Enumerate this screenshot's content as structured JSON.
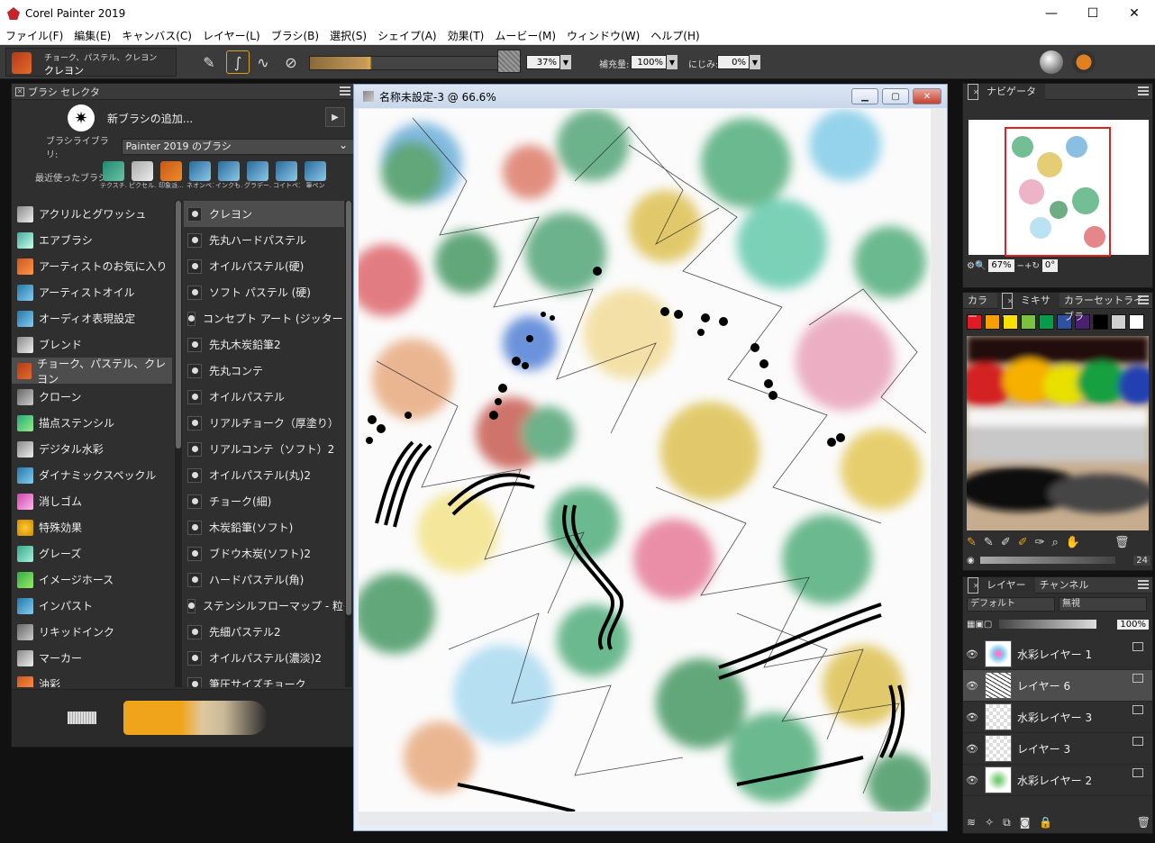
{
  "app": {
    "title": "Corel Painter 2019"
  },
  "window_controls": {
    "minimize": "—",
    "maximize": "☐",
    "close": "✕"
  },
  "menu": [
    "ファイル(F)",
    "編集(E)",
    "キャンバス(C)",
    "レイヤー(L)",
    "ブラシ(B)",
    "選択(S)",
    "シェイプ(A)",
    "効果(T)",
    "ムービー(M)",
    "ウィンドウ(W)",
    "ヘルプ(H)"
  ],
  "propbar": {
    "brush_category": "チョーク、パステル、クレヨン",
    "brush_variant": "クレヨン",
    "opacity": "37%",
    "resaturation_label": "補充量:",
    "resaturation": "100%",
    "bleed_label": "にじみ:",
    "bleed": "0%"
  },
  "brush_selector": {
    "title": "ブラシ セレクタ",
    "new_brush": "新ブラシの追加...",
    "library_label": "ブラシライブラリ:",
    "library": "Painter 2019 のブラシ",
    "recent_label": "最近使ったブラシ:",
    "recent": [
      "テクスチ...",
      "ピクセル...",
      "印象派...",
      "ネオンペン",
      "インクも...",
      "グラデー...",
      "コイトペン",
      "筆ペン"
    ],
    "categories": [
      "アクリルとグワッシュ",
      "エアブラシ",
      "アーティストのお気に入り",
      "アーティストオイル",
      "オーディオ表現設定",
      "ブレンド",
      "チョーク、パステル、クレヨン",
      "クローン",
      "描点ステンシル",
      "デジタル水彩",
      "ダイナミックスペックル",
      "消しゴム",
      "特殊効果",
      "グレーズ",
      "イメージホース",
      "インパスト",
      "リキッドインク",
      "マーカー",
      "油彩"
    ],
    "selected_category": 6,
    "variants": [
      "クレヨン",
      "先丸ハードパステル",
      "オイルパステル(硬)",
      "ソフト パステル (硬)",
      "コンセプト アート (ジッター スムーズ)",
      "先丸木炭鉛筆2",
      "先丸コンテ",
      "オイルパステル",
      "リアルチョーク（厚塗り）",
      "リアルコンテ（ソフト）2",
      "オイルパステル(丸)2",
      "チョーク(細)",
      "木炭鉛筆(ソフト)",
      "ブドウ木炭(ソフト)2",
      "ハードパステル(角)",
      "ステンシルフローマップ - 粒子感パステル",
      "先細パステル2",
      "オイルパステル(濃淡)2",
      "筆圧サイズチョーク"
    ],
    "selected_variant": 0
  },
  "document": {
    "title": "名称未設定-3 @ 66.6%"
  },
  "navigator": {
    "title": "ナビゲータ",
    "zoom": "67%",
    "rotation": "0°"
  },
  "color_panel": {
    "tabs": [
      "カラー",
      "ミキサー",
      "カラーセットライブラ"
    ],
    "swatches": [
      "#e01b24",
      "#f5a000",
      "#f6e000",
      "#7cc242",
      "#0a9b4a",
      "#3050a0",
      "#4a2070",
      "#000000",
      "#d0d0d0",
      "#ffffff"
    ],
    "brush_size": "24"
  },
  "layers_panel": {
    "tabs": [
      "レイヤー",
      "チャンネル"
    ],
    "composite_method": "デフォルト",
    "preserve": "無視",
    "opacity": "100%",
    "layers": [
      {
        "name": "水彩レイヤー 1",
        "selected": false
      },
      {
        "name": "レイヤー 6",
        "selected": true
      },
      {
        "name": "水彩レイヤー 3",
        "selected": false
      },
      {
        "name": "レイヤー 3",
        "selected": false
      },
      {
        "name": "水彩レイヤー 2",
        "selected": false
      }
    ]
  },
  "colors": {
    "panel_bg": "#2f2f2f",
    "accent": "#e0a020",
    "selection": "#4d4d4d"
  }
}
